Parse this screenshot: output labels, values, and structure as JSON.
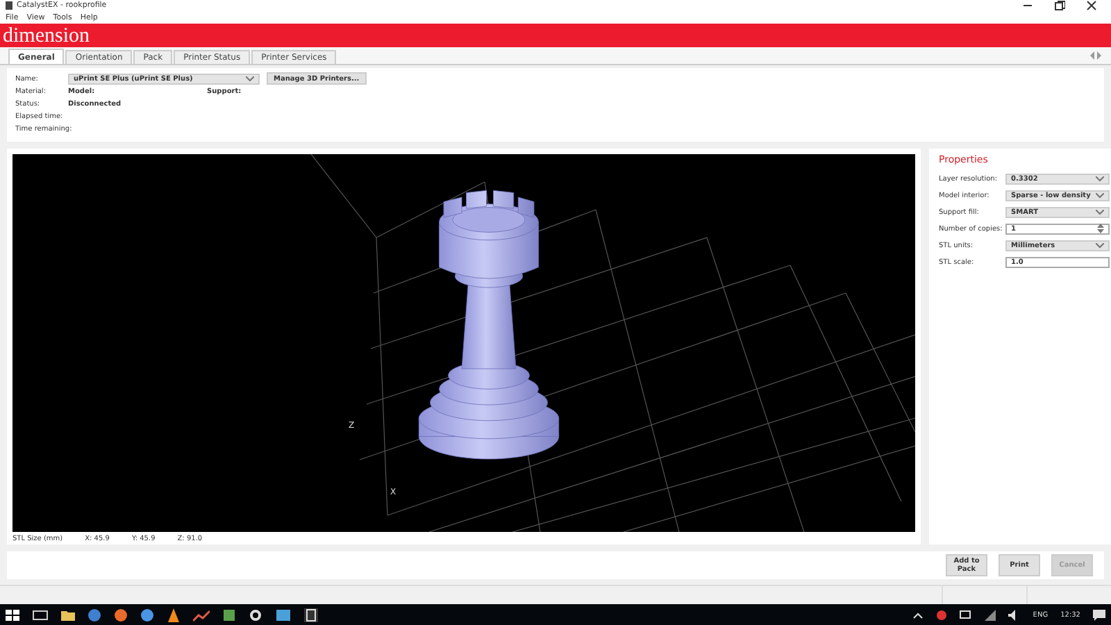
{
  "window": {
    "title": "CatalystEX - rookprofile"
  },
  "menu": [
    "File",
    "View",
    "Tools",
    "Help"
  ],
  "brand": "dimension",
  "tabs": [
    {
      "label": "General",
      "selected": true
    },
    {
      "label": "Orientation",
      "selected": false
    },
    {
      "label": "Pack",
      "selected": false
    },
    {
      "label": "Printer Status",
      "selected": false
    },
    {
      "label": "Printer Services",
      "selected": false
    }
  ],
  "printer": {
    "name_label": "Name:",
    "name_value": "uPrint SE Plus  (uPrint SE Plus)",
    "manage_button": "Manage 3D Printers...",
    "material_label": "Material:",
    "model_label": "Model:",
    "support_label": "Support:",
    "status_label": "Status:",
    "status_value": "Disconnected",
    "elapsed_label": "Elapsed time:",
    "remaining_label": "Time remaining:"
  },
  "properties": {
    "title": "Properties",
    "fields": [
      {
        "kind": "dropdown",
        "label": "Layer resolution:",
        "value": "0.3302"
      },
      {
        "kind": "dropdown",
        "label": "Model interior:",
        "value": "Sparse - low density"
      },
      {
        "kind": "dropdown",
        "label": "Support fill:",
        "value": "SMART"
      },
      {
        "kind": "spinner",
        "label": "Number of copies:",
        "value": "1"
      },
      {
        "kind": "dropdown",
        "label": "STL units:",
        "value": "Millimeters"
      },
      {
        "kind": "text",
        "label": "STL scale:",
        "value": "1.0"
      }
    ]
  },
  "stl_size": {
    "label": "STL Size (mm)",
    "x": "X: 45.9",
    "y": "Y: 45.9",
    "z": "Z: 91.0"
  },
  "axis_labels": {
    "z": "Z",
    "x": "X"
  },
  "buttons": [
    {
      "label": "Add to Pack",
      "disabled": false
    },
    {
      "label": "Print",
      "disabled": false
    },
    {
      "label": "Cancel",
      "disabled": true
    }
  ],
  "taskbar": {
    "language": "ENG",
    "time": "12:32"
  }
}
